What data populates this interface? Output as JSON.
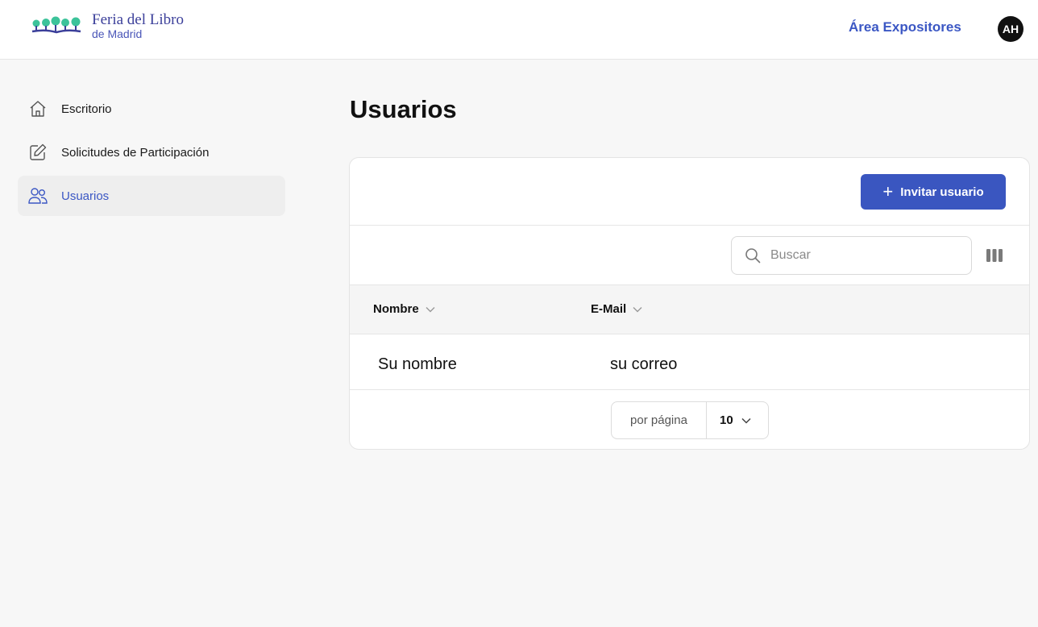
{
  "header": {
    "logo_title": "Feria del Libro",
    "logo_subtitle": "de Madrid",
    "area_link": "Área Expositores",
    "avatar_initials": "AH"
  },
  "sidebar": {
    "items": [
      {
        "label": "Escritorio",
        "icon": "home-icon",
        "active": false
      },
      {
        "label": "Solicitudes de Participación",
        "icon": "edit-icon",
        "active": false
      },
      {
        "label": "Usuarios",
        "icon": "users-icon",
        "active": true
      }
    ]
  },
  "page": {
    "title": "Usuarios"
  },
  "toolbar": {
    "invite_label": "Invitar usuario",
    "search_placeholder": "Buscar"
  },
  "table": {
    "columns": [
      "Nombre",
      "E-Mail"
    ],
    "rows": [
      {
        "name": "Su nombre",
        "email": "su correo"
      }
    ]
  },
  "pagination": {
    "per_page_label": "por página",
    "per_page_value": "10"
  },
  "colors": {
    "accent": "#3a56c0",
    "logo_green": "#3cc39a",
    "logo_blue": "#3b3f9a"
  }
}
